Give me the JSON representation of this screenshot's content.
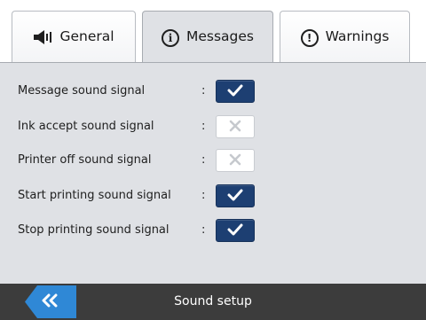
{
  "tabs": [
    {
      "label": "General",
      "icon": "speaker-icon",
      "active": false
    },
    {
      "label": "Messages",
      "icon": "info-icon",
      "active": true
    },
    {
      "label": "Warnings",
      "icon": "warning-icon",
      "active": false
    }
  ],
  "settings": {
    "separator": ":",
    "items": [
      {
        "label": "Message sound signal",
        "checked": true
      },
      {
        "label": "Ink accept sound signal",
        "checked": false
      },
      {
        "label": "Printer off sound signal",
        "checked": false
      },
      {
        "label": "Start printing sound signal",
        "checked": true
      },
      {
        "label": "Stop printing sound signal",
        "checked": true
      }
    ]
  },
  "footer": {
    "title": "Sound setup",
    "back_icon": "double-chevron-left-icon"
  },
  "colors": {
    "accent_blue": "#2f88d6",
    "checkbox_checked_bg": "#1d3f72",
    "panel_bg": "#dfe1e5",
    "footer_bg": "#3c3c3c"
  }
}
